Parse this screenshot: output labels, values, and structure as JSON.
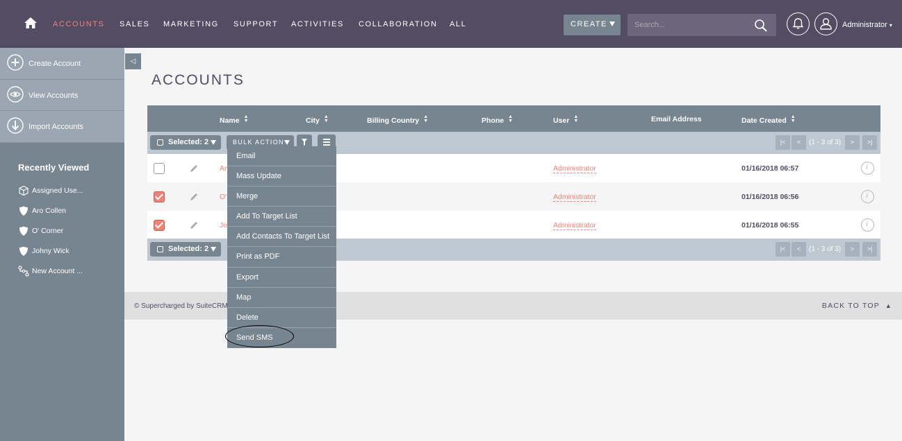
{
  "nav": {
    "items": [
      {
        "label": "ACCOUNTS",
        "active": true
      },
      {
        "label": "SALES",
        "active": false
      },
      {
        "label": "MARKETING",
        "active": false
      },
      {
        "label": "SUPPORT",
        "active": false
      },
      {
        "label": "ACTIVITIES",
        "active": false
      },
      {
        "label": "COLLABORATION",
        "active": false
      },
      {
        "label": "ALL",
        "active": false
      }
    ],
    "create_label": "CREATE",
    "search_placeholder": "Search...",
    "user_label": "Administrator"
  },
  "sidebar": {
    "actions": [
      {
        "label": "Create Account",
        "icon": "plus-circle-icon"
      },
      {
        "label": "View Accounts",
        "icon": "eye-circle-icon"
      },
      {
        "label": "Import Accounts",
        "icon": "download-circle-icon"
      }
    ],
    "recently_viewed_title": "Recently Viewed",
    "recent": [
      {
        "label": "Assigned Use...",
        "icon": "cube-icon"
      },
      {
        "label": "Aro Collen",
        "icon": "shield-icon"
      },
      {
        "label": "O' Corner",
        "icon": "shield-icon"
      },
      {
        "label": "Johny Wick",
        "icon": "shield-icon"
      },
      {
        "label": "New Account ...",
        "icon": "workflow-icon"
      }
    ]
  },
  "page": {
    "title": "ACCOUNTS"
  },
  "table": {
    "columns": [
      "Name",
      "City",
      "Billing Country",
      "Phone",
      "User",
      "Email Address",
      "Date Created"
    ],
    "selected_label": "Selected: 2",
    "bulk_action_label": "BULK ACTION",
    "pagination": "(1 - 3 of 3)",
    "pagination_buttons": [
      "|<",
      "<",
      ">",
      ">|"
    ],
    "rows": [
      {
        "name": "An",
        "user": "Administrator",
        "date": "01/16/2018 06:57",
        "checked": false
      },
      {
        "name": "O'",
        "user": "Administrator",
        "date": "01/16/2018 06:56",
        "checked": true
      },
      {
        "name": "Jo",
        "user": "Administrator",
        "date": "01/16/2018 06:55",
        "checked": true
      }
    ]
  },
  "bulk_menu": {
    "items": [
      "Email",
      "Mass Update",
      "Merge",
      "Add To Target List",
      "Add Contacts To Target List",
      "Print as PDF",
      "Export",
      "Map",
      "Delete",
      "Send SMS"
    ]
  },
  "footer": {
    "text": "© Supercharged by SuiteCRM",
    "back_to_top": "BACK TO TOP"
  },
  "colors": {
    "nav_bg": "#534d64",
    "accent": "#f08377",
    "sidebar_bg": "#778591",
    "table_header_bg": "#778591",
    "action_bar_bg": "#bdc8d1"
  }
}
